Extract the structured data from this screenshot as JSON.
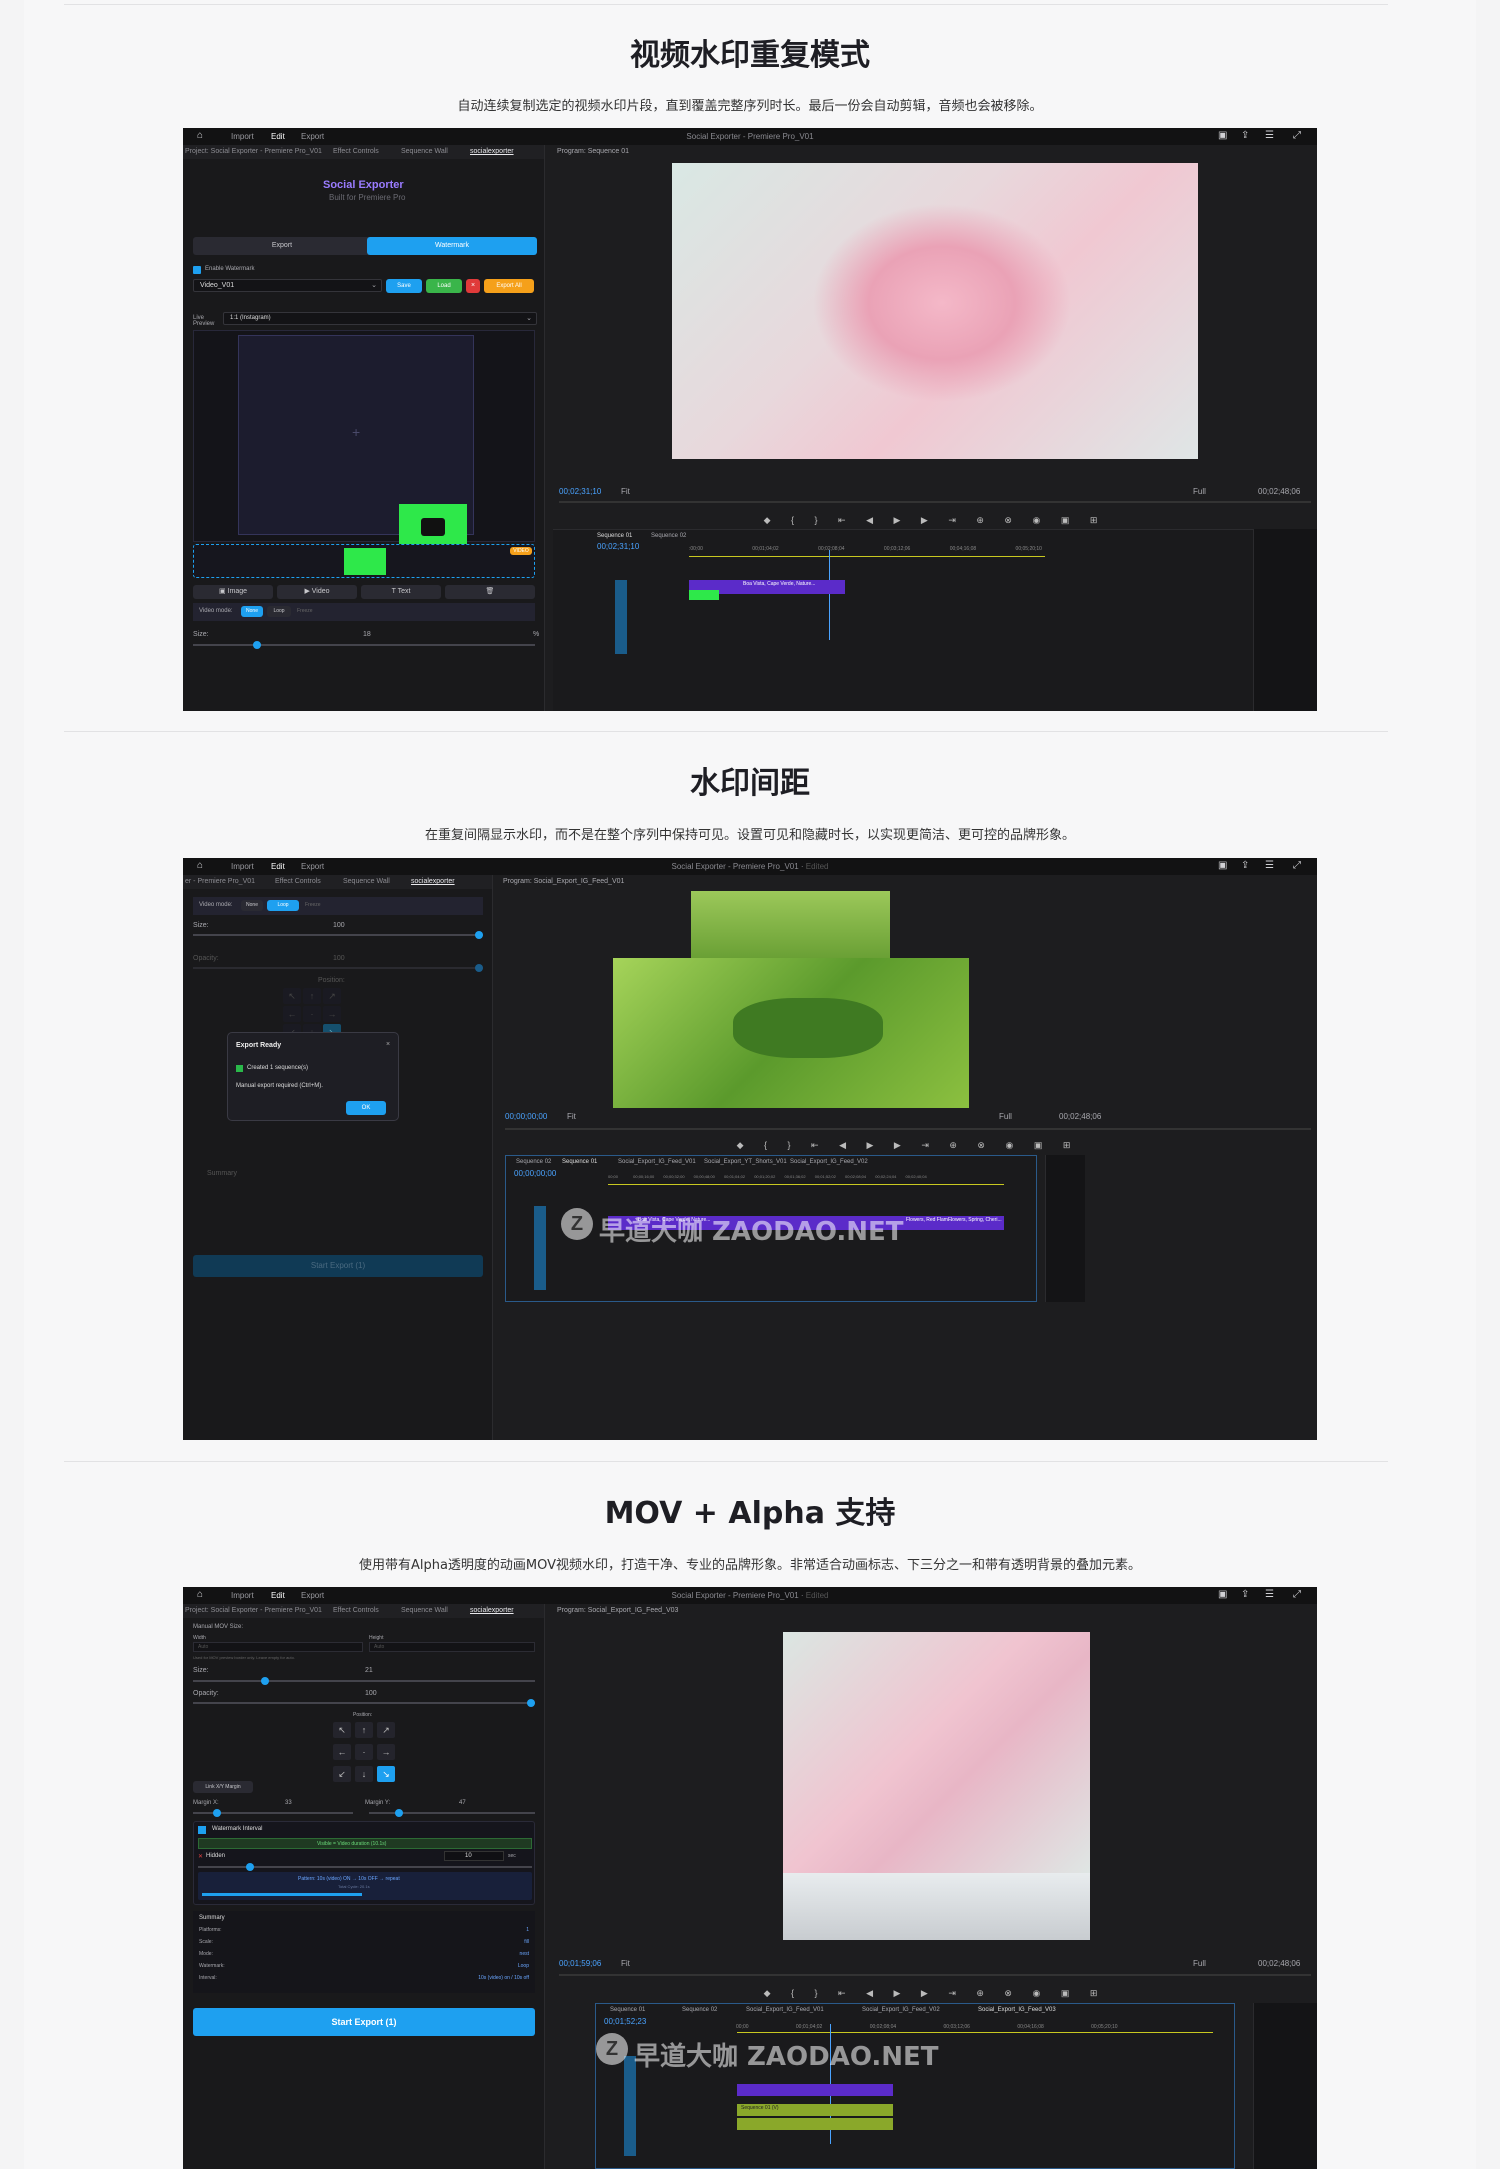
{
  "sections": [
    {
      "title": "视频水印重复模式",
      "desc": "自动连续复制选定的视频水印片段，直到覆盖完整序列时长。最后一份会自动剪辑，音频也会被移除。"
    },
    {
      "title": "水印间距",
      "desc": "在重复间隔显示水印，而不是在整个序列中保持可见。设置可见和隐藏时长，以实现更简洁、更可控的品牌形象。"
    },
    {
      "title": "MOV + Alpha 支持",
      "desc": "使用带有Alpha透明度的动画MOV视频水印，打造干净、专业的品牌形象。非常适合动画标志、下三分之一和带有透明背景的叠加元素。"
    }
  ],
  "app": {
    "menu": [
      "Import",
      "Edit",
      "Export"
    ],
    "title1": "Social Exporter - Premiere Pro_V01",
    "title2": "Social Exporter - Premiere Pro_V01",
    "edited": "Edited",
    "icons": [
      "home-icon",
      "layout-icon",
      "share-icon",
      "menu-icon",
      "expand-icon"
    ]
  },
  "shot1": {
    "panel_tabs": [
      "Project: Social Exporter - Premiere Pro_V01",
      "Effect Controls",
      "Sequence Wall",
      "socialexporter"
    ],
    "brand": "Social Exporter",
    "built_for": "Built for Premiere Pro",
    "tab_export": "Export",
    "tab_watermark": "Watermark",
    "enable_label": "Enable Watermark",
    "preset": "Video_V01",
    "btn_save": "Save",
    "btn_load": "Load",
    "btn_export_all": "Export All",
    "live_preview": "Live Preview",
    "aspect": "1:1 (Instagram)",
    "video_badge": "VIDEO",
    "btn_image": "Image",
    "btn_video": "Video",
    "btn_text": "Text",
    "video_mode_label": "Video mode:",
    "mode_none": "None",
    "mode_loop": "Loop",
    "mode_freeze": "Freeze",
    "size_label": "Size:",
    "size_value": "18",
    "pct": "%",
    "program_label": "Program: Sequence 01",
    "timecode": "00;02;31;10",
    "fit": "Fit",
    "full": "Full",
    "duration": "00;02;48;06",
    "seq_tabs": [
      "Sequence 01",
      "Sequence 02"
    ],
    "tl_timecode": "00;02;31;10",
    "ruler": [
      ":00;00",
      "00;01;04;02",
      "00;02;08;04",
      "00;03;12;06",
      "00;04;16;08",
      "00;05;20;10"
    ],
    "clip_label": "Boa Vista, Cape Verde, Nature..."
  },
  "shot2": {
    "panel_tabs": [
      "er - Premiere Pro_V01",
      "Effect Controls",
      "Sequence Wall",
      "socialexporter"
    ],
    "video_mode_label": "Video mode:",
    "mode_none": "None",
    "mode_loop": "Loop",
    "mode_freeze": "Freeze",
    "size_label": "Size:",
    "size_value": "100",
    "opacity_label": "Opacity:",
    "opacity_value": "100",
    "position_label": "Position:",
    "dialog_title": "Export Ready",
    "dialog_created": "Created 1 sequence(s)",
    "dialog_manual": "Manual export required (Ctrl+M).",
    "dialog_ok": "OK",
    "summary_label": "Summary",
    "start_export": "Start Export (1)",
    "program_label": "Program: Social_Export_IG_Feed_V01",
    "timecode": "00;00;00;00",
    "fit": "Fit",
    "full": "Full",
    "duration": "00;02;48;06",
    "seq_tabs": [
      "Sequence 02",
      "Sequence 01",
      "Social_Export_IG_Feed_V01",
      "Social_Export_YT_Shorts_V01",
      "Social_Export_IG_Feed_V02"
    ],
    "tl_timecode": "00;00;00;00",
    "ruler": [
      "00;00",
      "00;00;16;00",
      "00;00;32;00",
      "00;00;48;00",
      "00;01;04;02",
      "00;01;20;02",
      "00;01;36;02",
      "00;01;52;02",
      "00;02;08;04",
      "00;02;24;04",
      "00;02;40;04"
    ],
    "clips": [
      "Boa Vista, Cape Verde, Nature...",
      "Flowers, Red Flam...",
      "Flowers, Spring, Cheri..."
    ]
  },
  "shot3": {
    "panel_tabs": [
      "Project: Social Exporter - Premiere Pro_V01",
      "Effect Controls",
      "Sequence Wall",
      "socialexporter"
    ],
    "manual_size": "Manual MOV Size:",
    "width_label": "Width",
    "height_label": "Height",
    "auto": "Auto",
    "hint": "Used for MOV preview border only. Leave empty for auto.",
    "size_label": "Size:",
    "size_value": "21",
    "opacity_label": "Opacity:",
    "opacity_value": "100",
    "position_label": "Position:",
    "link_margin": "Link X/Y Margin",
    "margin_x_label": "Margin X:",
    "margin_x": "33",
    "margin_y_label": "Margin Y:",
    "margin_y": "47",
    "interval_label": "Watermark Interval",
    "visible_info": "Visible = Video duration (10.1s)",
    "hidden_label": "Hidden",
    "hidden_value": "10",
    "hidden_unit": "sec",
    "pattern": "Pattern: 10s (video) ON → 10s OFF → repeat",
    "total_cycle": "Total Cycle: 20.1s",
    "summary_label": "Summary",
    "summary_rows": [
      {
        "k": "Platforms:",
        "v": "1"
      },
      {
        "k": "Scale:",
        "v": "fill"
      },
      {
        "k": "Mode:",
        "v": "nest"
      },
      {
        "k": "Watermark:",
        "v": "Loop"
      },
      {
        "k": "Interval:",
        "v": "10s (video) on / 10s off"
      }
    ],
    "start_export": "Start Export (1)",
    "program_label": "Program: Social_Export_IG_Feed_V03",
    "timecode": "00;01;59;06",
    "fit": "Fit",
    "full": "Full",
    "duration": "00;02;48;06",
    "seq_tabs": [
      "Sequence 01",
      "Sequence 02",
      "Social_Export_IG_Feed_V01",
      "Social_Export_IG_Feed_V02",
      "Social_Export_IG_Feed_V03"
    ],
    "tl_timecode": "00;01;52;23",
    "ruler": [
      "00;00",
      "00;01;04;02",
      "00;02;08;04",
      "00;03;12;06",
      "00;04;16;08",
      "00;05;20;10"
    ],
    "clip_label": "Sequence 01 (V)"
  },
  "watermark": {
    "logo": "Z",
    "text": "早道大咖 ZAODAO.NET"
  }
}
